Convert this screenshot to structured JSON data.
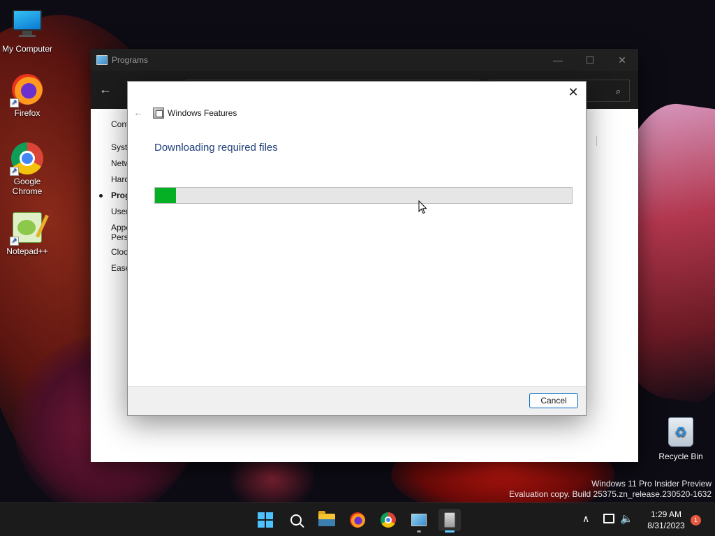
{
  "desktop": {
    "icons": [
      {
        "label": "My Computer"
      },
      {
        "label": "Firefox"
      },
      {
        "label": "Google Chrome"
      },
      {
        "label": "Notepad++"
      },
      {
        "label": "Recycle Bin"
      }
    ],
    "watermark": {
      "line1": "Windows 11 Pro Insider Preview",
      "line2": "Evaluation copy. Build 25375.zn_release.230520-1632"
    }
  },
  "programs_window": {
    "title": "Programs",
    "controls": {
      "minimize": "—",
      "maximize": "☐",
      "close": "✕"
    },
    "nav_items": [
      "Cont",
      "Syste",
      "Netw",
      "Hard",
      "Prog",
      "User",
      "Appe",
      "Perso",
      "Clock",
      "Ease"
    ],
    "link_fragment": "s"
  },
  "dialog": {
    "title": "Windows Features",
    "heading": "Downloading required files",
    "progress_fraction": 0.05,
    "progress_color": "#06b025",
    "cancel_label": "Cancel",
    "close_glyph": "✕",
    "back_glyph": "←"
  },
  "taskbar": {
    "apps": [
      "start-icon",
      "search-icon",
      "file-explorer-icon",
      "firefox-icon",
      "chrome-icon",
      "control-panel-icon",
      "windows-features-icon"
    ],
    "clock_time": "1:29 AM",
    "clock_date": "8/31/2023",
    "notification_count": "1",
    "accent": "#60cdff"
  }
}
